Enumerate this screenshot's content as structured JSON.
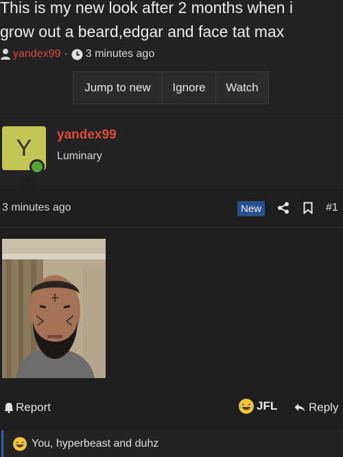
{
  "thread": {
    "title_line1": "This is my new look after 2 months when i",
    "title_line2": "grow out a beard,edgar and face tat max",
    "author": "yandex99",
    "separator": "·",
    "time": "3 minutes ago"
  },
  "actions": {
    "jump_label": "Jump to new",
    "ignore_label": "Ignore",
    "watch_label": "Watch"
  },
  "post": {
    "avatar_letter": "Y",
    "username": "yandex99",
    "user_title": "Luminary",
    "time": "3 minutes ago",
    "new_badge": "New",
    "post_number": "#1",
    "report_label": "Report",
    "reaction_label": "JFL",
    "reply_label": "Reply",
    "reactions_summary": "You, hyperbeast and duhz"
  },
  "colors": {
    "background": "#222223",
    "author_red": "#e0493e",
    "badge_blue": "#2b4f8c",
    "avatar_yellow": "#c3c556",
    "online_green": "#56a23b"
  },
  "icons": [
    "user-icon",
    "clock-icon",
    "share-icon",
    "bookmark-icon",
    "report-icon",
    "laughing-emoji-icon",
    "reply-arrow-icon"
  ]
}
